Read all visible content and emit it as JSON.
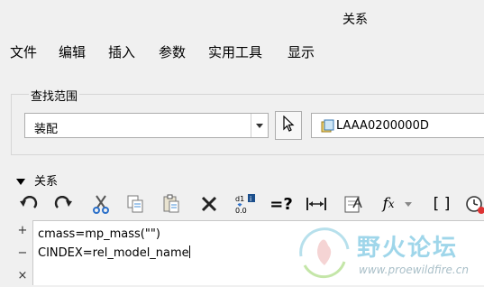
{
  "window": {
    "title": "关系"
  },
  "menu": {
    "items": [
      "文件",
      "编辑",
      "插入",
      "参数",
      "实用工具",
      "显示"
    ]
  },
  "search_scope": {
    "legend": "查找范围",
    "scope_value": "装配",
    "model_name": "LAAA0200000D"
  },
  "relations": {
    "header": "关系",
    "toolbar_icons": [
      "undo-icon",
      "redo-icon",
      "cut-icon",
      "copy-icon",
      "paste-icon",
      "delete-icon",
      "switch-dimensions-icon",
      "evaluate-icon",
      "measure-icon",
      "sort-icon",
      "function-icon",
      "brackets-icon",
      "execute-icon"
    ],
    "side_buttons": {
      "add": "+",
      "remove": "−",
      "close": "×"
    },
    "lines": [
      "cmass=mp_mass(\"\")",
      "CINDEX=rel_model_name"
    ]
  },
  "watermark": {
    "text": "野火论坛",
    "url": "www.proewildfire.cn"
  },
  "colors": {
    "background": "#f0f0f0",
    "field_bg": "#ffffff",
    "border": "#adadad",
    "watermark": "#9fd6ea"
  }
}
